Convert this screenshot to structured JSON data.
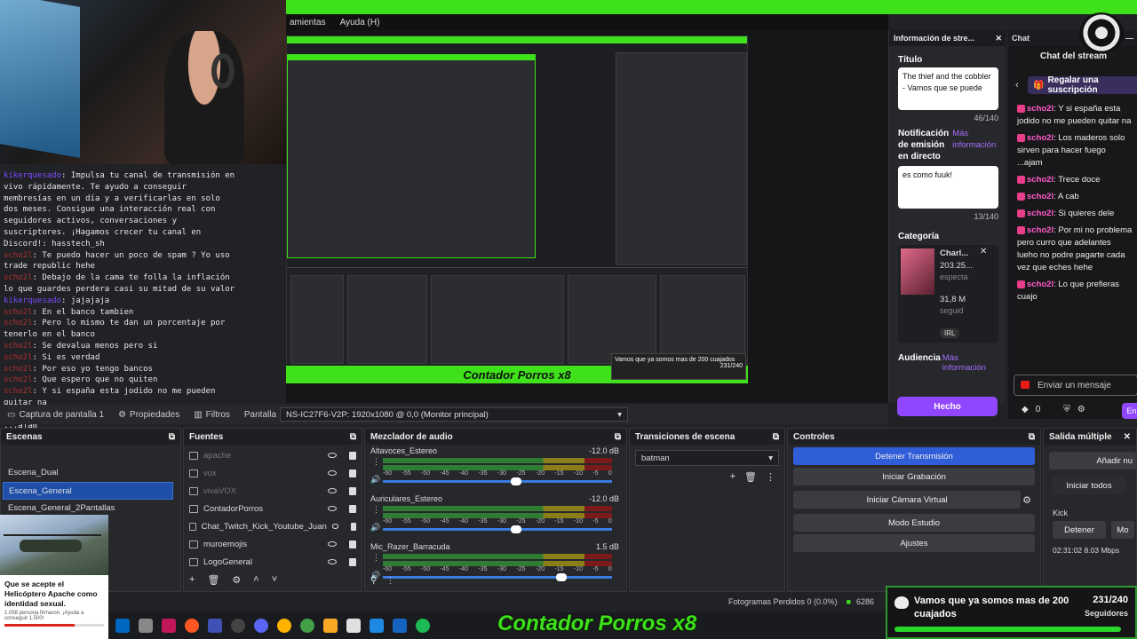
{
  "menu": {
    "items": [
      "amientas",
      "Ayuda (H)"
    ]
  },
  "overlay_chat": [
    {
      "user": "kikerquesado",
      "text": ": Impulsa tu canal de transmisión en vivo rápidamente. Te ayudo a conseguir membresías en un día y a verificarlas en solo dos meses. Consigue una interacción real con seguidores activos, conversaciones y suscriptores. ¡Hagamos crecer tu canal en Discord!: hasstech_sh"
    },
    {
      "user": "scho2l",
      "text": ": Te puedo hacer un poco de spam ? Yo uso trade republic hehe"
    },
    {
      "user": "scho2l",
      "text": ": Debajo de la cama te folla la inflación lo que guardes perdera casi su mitad de su valor"
    },
    {
      "user": "kikerquesado",
      "text": ": jajajaja"
    },
    {
      "user": "scho2l",
      "text": ": En el banco tambien"
    },
    {
      "user": "scho2l",
      "text": ": Pero lo mismo te dan un porcentaje por tenerlo en el banco"
    },
    {
      "user": "scho2l",
      "text": ": Se devalua menos pero si"
    },
    {
      "user": "scho2l",
      "text": ": Si es verdad"
    },
    {
      "user": "scho2l",
      "text": ": Por eso yo tengo bancos"
    },
    {
      "user": "scho2l",
      "text": ": Que espero que no quiten"
    },
    {
      "user": "scho2l",
      "text": ": Y si españa esta jodido no me pueden quitar na"
    },
    {
      "user": "scho2l",
      "text": ": Los maderos solo sirven para hacer fuego ...ajam"
    },
    {
      "user": "scho2l",
      "text": ": A cab"
    },
    {
      "user": "scho2l",
      "text": ": Si quieres dele"
    },
    {
      "user": "scho2l",
      "text": ": Por mi no problema pero curro que adelantes lueho no podre pagarte cada vez que eches hehe"
    },
    {
      "user": "scho2l",
      "text": ": Lo que prefieras cuajo"
    }
  ],
  "nested_preview": {
    "counter": "Contador Porros x8",
    "goal_text": "Vamos que ya somos mas de 200 cuajados",
    "goal_count": "231/240"
  },
  "stream_info": {
    "header": "Información de stre...",
    "title_label": "Título",
    "title_value": "The thief and the cobbler - Vamos que se puede",
    "title_count": "46/140",
    "notif_label": "Notificación de emisión en directo",
    "more_info": "Más información",
    "notif_value": "es como fuuk!",
    "notif_count": "13/140",
    "category_label": "Categoría",
    "category_name": "Charl...",
    "category_viewers": "203.25...",
    "category_viewers_sub": "especta",
    "category_followers": "31,8 M",
    "category_followers_sub": "seguid",
    "category_tag": "IRL",
    "audience_label": "Audiencia",
    "done": "Hecho"
  },
  "twitch_chat": {
    "header": "Chat",
    "title": "Chat del stream",
    "gift": "Regalar una suscripción",
    "messages": [
      {
        "user": "scho2l",
        "text": ": Y si españa esta jodido no me pueden quitar na"
      },
      {
        "user": "scho2l",
        "text": ": Los maderos solo sirven para hacer fuego ...ajam"
      },
      {
        "user": "scho2l",
        "text": ": Trece doce"
      },
      {
        "user": "scho2l",
        "text": ": A cab"
      },
      {
        "user": "scho2l",
        "text": ": Si quieres dele"
      },
      {
        "user": "scho2l",
        "text": ": Por mi no problema pero curro que adelantes lueho no podre pagarte cada vez que eches hehe"
      },
      {
        "user": "scho2l",
        "text": ": Lo que prefieras cuajo"
      }
    ],
    "input_placeholder": "Enviar un mensaje",
    "points": "0",
    "send": "En"
  },
  "toolbar": {
    "capture": "Captura de pantalla 1",
    "properties": "Propiedades",
    "filters": "Filtros",
    "screen_label": "Pantalla",
    "screen_value": "NS-IC27F6-V2P: 1920x1080 @ 0,0 (Monitor principal)"
  },
  "scenes": {
    "header": "Escenas",
    "items": [
      "Escena_Dual",
      "Escena_General",
      "Escena_General_2Pantallas"
    ]
  },
  "sources": {
    "header": "Fuentes",
    "items": [
      {
        "name": "apache",
        "dim": true
      },
      {
        "name": "vox",
        "dim": true
      },
      {
        "name": "vivaVOX",
        "dim": true
      },
      {
        "name": "ContadorPorros",
        "dim": false
      },
      {
        "name": "Chat_Twitch_Kick_Youtube_Juan",
        "dim": false
      },
      {
        "name": "muroemojis",
        "dim": false
      },
      {
        "name": "LogoGeneral",
        "dim": false
      }
    ]
  },
  "mixer": {
    "header": "Mezclador de audio",
    "tracks": [
      {
        "name": "Altavoces_Estereo",
        "db": "-12.0 dB",
        "level": 0.58
      },
      {
        "name": "Auriculares_Estereo",
        "db": "-12.0 dB",
        "level": 0.58
      },
      {
        "name": "Mic_Razer_Barracuda",
        "db": "1.5 dB",
        "level": 0.78
      }
    ],
    "scale": [
      "-60",
      "-55",
      "-50",
      "-45",
      "-40",
      "-35",
      "-30",
      "-25",
      "-20",
      "-15",
      "-10",
      "-5",
      "0"
    ]
  },
  "transitions": {
    "header": "Transiciones de escena",
    "value": "batman"
  },
  "controls": {
    "header": "Controles",
    "buttons": [
      "Detener Transmisión",
      "Iniciar Grabación",
      "Iniciar Cámara Virtual",
      "Modo Estudio",
      "Ajustes"
    ]
  },
  "multi_output": {
    "header": "Salida múltiple",
    "add": "Añadir nu",
    "start_all": "Iniciar todos",
    "target": "Kick",
    "stop": "Detener",
    "more": "Mo",
    "stats": "02:31:02  8.03 Mbps"
  },
  "status": {
    "frames": "Fotogramas Perdidos 0 (0.0%)",
    "extra": "6286"
  },
  "overlay": {
    "counter": "Contador Porros x8",
    "goal_text": "Vamos que ya somos mas de 200 cuajados",
    "goal_count": "231/240",
    "goal_label": "Seguidores",
    "goal_fraction": 0.9625
  },
  "notification_card": {
    "text": "Que se acepte el Helicóptero Apache como identidad sexual.",
    "small": "1.058 persona firmaron. ¡Ayuda a conseguir 1.500!"
  }
}
